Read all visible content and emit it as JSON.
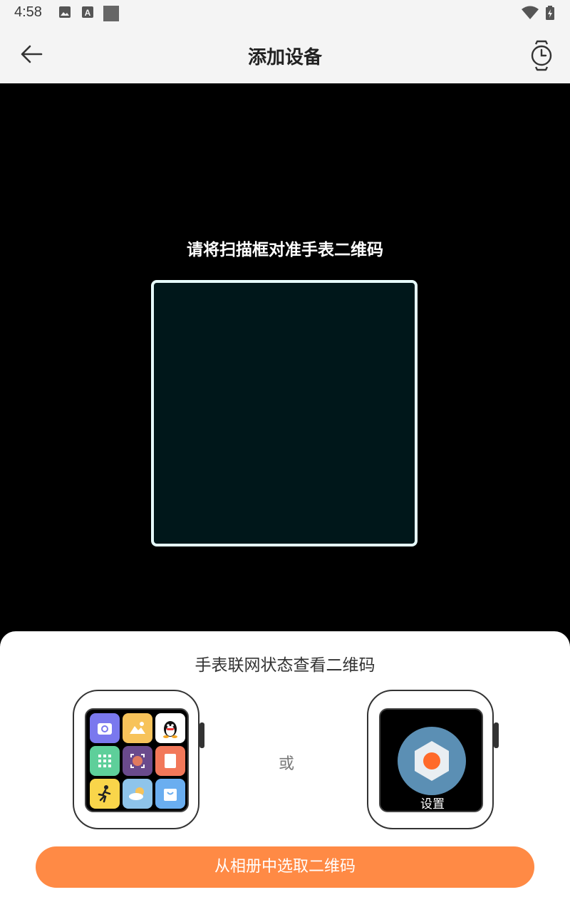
{
  "status_bar": {
    "time": "4:58",
    "icons": [
      "image-icon",
      "text-a-icon",
      "square-icon",
      "wifi-icon",
      "battery-charging-icon"
    ]
  },
  "app_bar": {
    "title": "添加设备",
    "back_icon": "arrow-left-icon",
    "action_icon": "watch-icon"
  },
  "scanner": {
    "hint": "请将扫描框对准手表二维码",
    "frame_color": "#e6fbfb"
  },
  "sheet": {
    "title": "手表联网状态查看二维码",
    "or_text": "或",
    "settings_label": "设置",
    "button_label": "从相册中选取二维码",
    "accent_color": "#ff8a45"
  }
}
